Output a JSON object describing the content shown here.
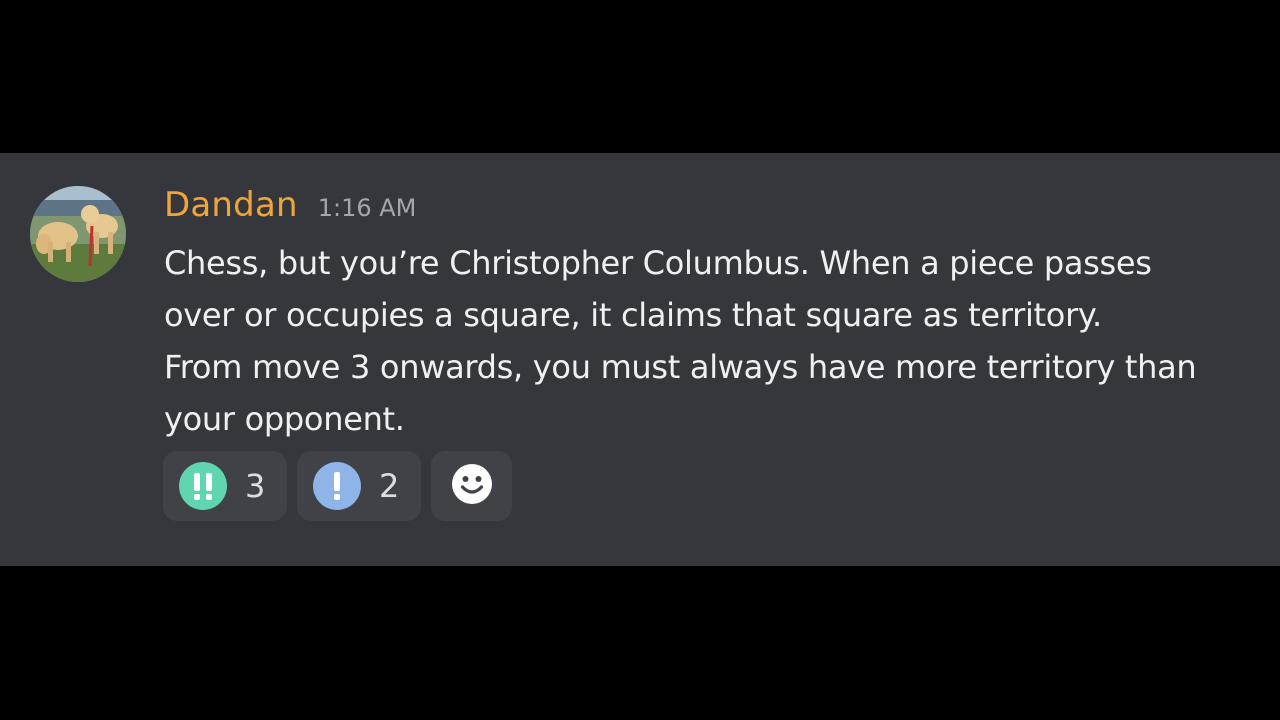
{
  "message": {
    "username": "Dandan",
    "timestamp": "1:16 AM",
    "lines": [
      "Chess, but you’re Christopher Columbus. When a piece passes",
      "over or occupies a square, it claims that square as territory.",
      "From move 3 onwards, you must always have more territory than",
      "your opponent."
    ],
    "username_color": "#f0a53a"
  },
  "reactions": [
    {
      "icon": "double-exclamation-icon",
      "color": "#5fd6b0",
      "count": "3"
    },
    {
      "icon": "exclamation-icon",
      "color": "#8fb4e8",
      "count": "2"
    }
  ],
  "add_reaction": {
    "icon": "smiley-add-reaction-icon"
  }
}
